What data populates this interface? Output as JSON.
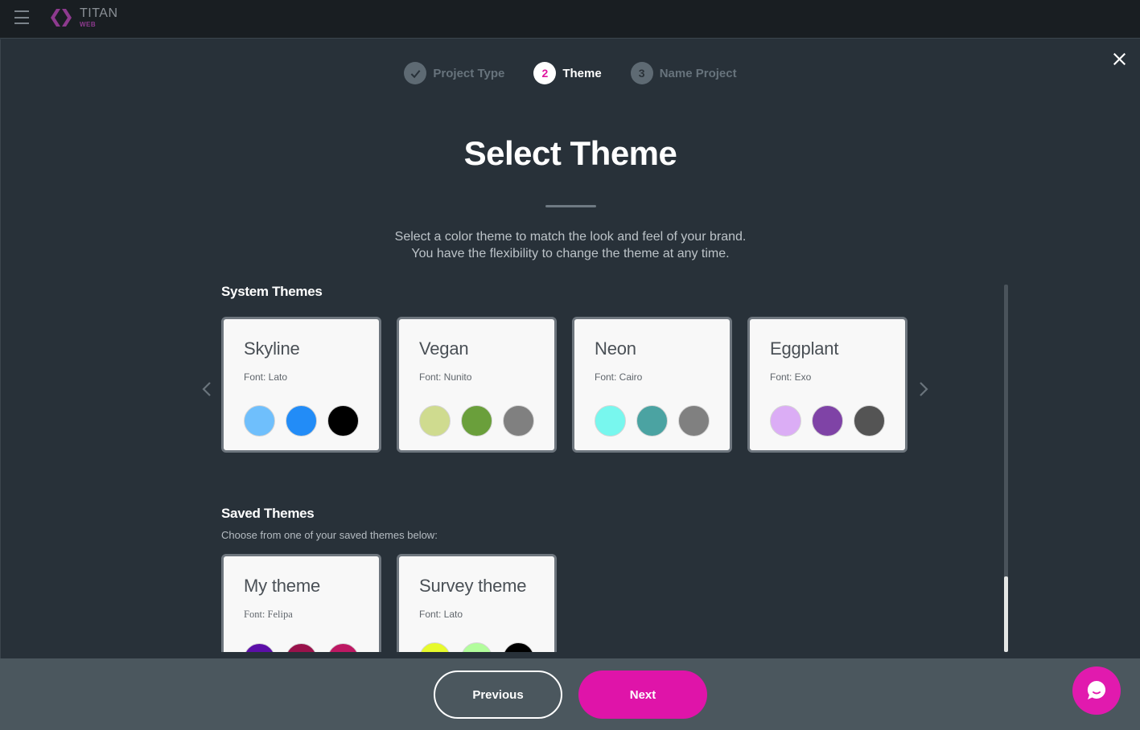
{
  "app": {
    "logo_title": "TITAN",
    "logo_subtitle": "WEB"
  },
  "stepper": {
    "steps": [
      {
        "number": "1",
        "label": "Project Type",
        "state": "done"
      },
      {
        "number": "2",
        "label": "Theme",
        "state": "active"
      },
      {
        "number": "3",
        "label": "Name Project",
        "state": "todo"
      }
    ]
  },
  "page": {
    "title": "Select Theme",
    "subtitle_line1": "Select a color theme to match the look and feel of your brand.",
    "subtitle_line2": "You have the flexibility to change the theme at any time."
  },
  "system_themes": {
    "title": "System Themes",
    "items": [
      {
        "name": "Skyline",
        "font": "Font: Lato",
        "colors": [
          "#6fbffc",
          "#228cf7",
          "#000000"
        ]
      },
      {
        "name": "Vegan",
        "font": "Font: Nunito",
        "colors": [
          "#cfdb8f",
          "#6a9f3b",
          "#808080"
        ]
      },
      {
        "name": "Neon",
        "font": "Font: Cairo",
        "colors": [
          "#78f7ee",
          "#4ba3a2",
          "#808080"
        ]
      },
      {
        "name": "Eggplant",
        "font": "Font: Exo",
        "colors": [
          "#dbadf5",
          "#7f43a6",
          "#545454"
        ]
      }
    ]
  },
  "saved_themes": {
    "title": "Saved Themes",
    "description": "Choose from one of your saved themes below:",
    "items": [
      {
        "name": "My theme",
        "font": "Font: Felipa",
        "colors": [
          "#5c0fa8",
          "#99124b",
          "#bd1863"
        ]
      },
      {
        "name": "Survey theme",
        "font": "Font: Lato",
        "colors": [
          "#e7fa2c",
          "#b2fd9c",
          "#000000"
        ]
      }
    ]
  },
  "scroll": {
    "position_percent": 100
  },
  "footer": {
    "previous_label": "Previous",
    "next_label": "Next"
  },
  "colors": {
    "accent": "#df14a9",
    "background": "#283139",
    "topbar": "#191e22",
    "footer": "#4b575e"
  }
}
